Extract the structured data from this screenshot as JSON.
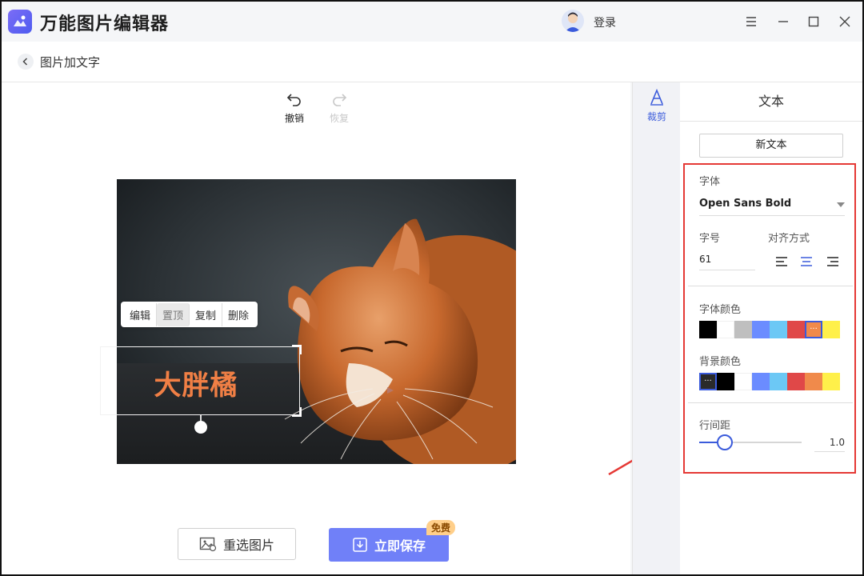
{
  "app": {
    "title": "万能图片编辑器",
    "login_label": "登录"
  },
  "header": {
    "page_title": "图片加文字"
  },
  "toolbar": {
    "undo_label": "撤销",
    "redo_label": "恢复"
  },
  "canvas": {
    "context_menu": [
      "编辑",
      "置顶",
      "复制",
      "删除"
    ],
    "text_content": "大胖橘",
    "text_color": "#f07f45"
  },
  "buttons": {
    "reselect_label": "重选图片",
    "save_label": "立即保存",
    "free_badge": "免费"
  },
  "tool_strip": {
    "crop_label": "裁剪"
  },
  "panel": {
    "title": "文本",
    "new_text_label": "新文本",
    "font_label": "字体",
    "font_value": "Open Sans Bold",
    "size_label": "字号",
    "size_value": "61",
    "align_label": "对齐方式",
    "align_selected": "center",
    "font_color_label": "字体颜色",
    "font_colors": [
      "#000000",
      "#ffffff",
      "#bfbfbf",
      "#6b8cff",
      "#6cc8f5",
      "#e04848",
      "#f08a4b",
      "#fff04a"
    ],
    "font_color_selected_index": 6,
    "bg_color_label": "背景颜色",
    "bg_colors": [
      "#2a2a2a",
      "#000000",
      "#ffffff",
      "#6b8cff",
      "#6cc8f5",
      "#e04848",
      "#f08a4b",
      "#fff04a"
    ],
    "bg_color_selected_index": 0,
    "spacing_label": "行间距",
    "spacing_value": "1.0",
    "spacing_fraction": 0.25
  },
  "colors": {
    "accent": "#3b5bdb",
    "save_button": "#7080f8",
    "highlight_box": "#e53935"
  }
}
